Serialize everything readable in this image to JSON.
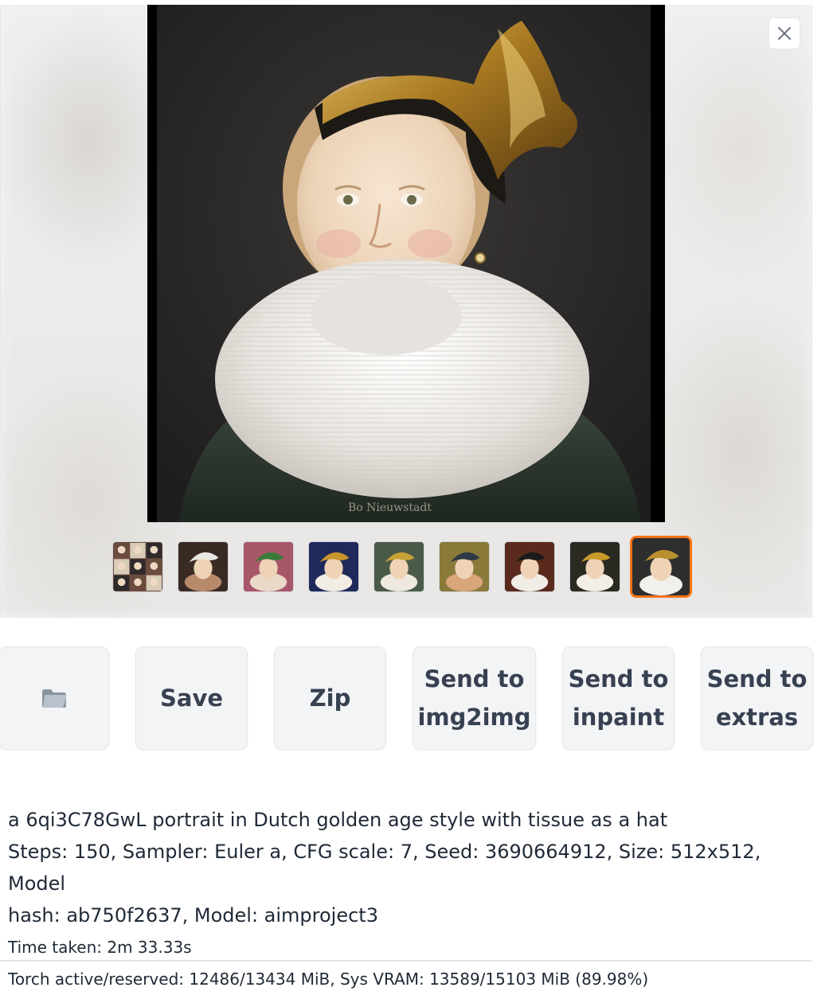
{
  "gallery": {
    "thumbnails": [
      {
        "name": "thumb-grid",
        "colors": [
          "#6b4b3e",
          "#d8cbb8",
          "#2e2a2a"
        ]
      },
      {
        "name": "thumb-white-hat",
        "colors": [
          "#3a2a24",
          "#e9e7e3",
          "#b88a6c"
        ]
      },
      {
        "name": "thumb-green-hat",
        "colors": [
          "#a8566a",
          "#3b7a3a",
          "#ead9c8"
        ]
      },
      {
        "name": "thumb-framed",
        "colors": [
          "#1f2a5a",
          "#c8952e",
          "#f2ede4"
        ]
      },
      {
        "name": "thumb-gold-bow",
        "colors": [
          "#4a5a48",
          "#c9a235",
          "#efe8df"
        ]
      },
      {
        "name": "thumb-profile",
        "colors": [
          "#8a7a3a",
          "#2b3a44",
          "#d9a57a"
        ]
      },
      {
        "name": "thumb-black-hat",
        "colors": [
          "#5a2a1c",
          "#1a1a1a",
          "#f0ece6"
        ]
      },
      {
        "name": "thumb-gold-hat",
        "colors": [
          "#2a2a22",
          "#c99a2a",
          "#f4efe6"
        ]
      },
      {
        "name": "thumb-tissue-hat",
        "colors": [
          "#2e2e2e",
          "#b8902e",
          "#f2f0ec"
        ]
      }
    ],
    "selected_index": 8,
    "accent_color": "#f97316"
  },
  "actions": {
    "folder_icon": "folder-icon",
    "save_label": "Save",
    "zip_label": "Zip",
    "send_img2img_line1": "Send to",
    "send_img2img_line2": "img2img",
    "send_inpaint_line1": "Send to",
    "send_inpaint_line2": "inpaint",
    "send_extras_line1": "Send to",
    "send_extras_line2": "extras"
  },
  "generation_info": {
    "prompt": "a 6qi3C78GwL portrait in Dutch golden age style with tissue as a hat",
    "params_line1": "Steps: 150, Sampler: Euler a, CFG scale: 7, Seed: 3690664912, Size: 512x512, Model",
    "params_line2": "hash: ab750f2637, Model: aimproject3",
    "time_taken": "Time taken: 2m 33.33s",
    "vram": "Torch active/reserved: 12486/13434 MiB, Sys VRAM: 13589/15103 MiB (89.98%)"
  }
}
